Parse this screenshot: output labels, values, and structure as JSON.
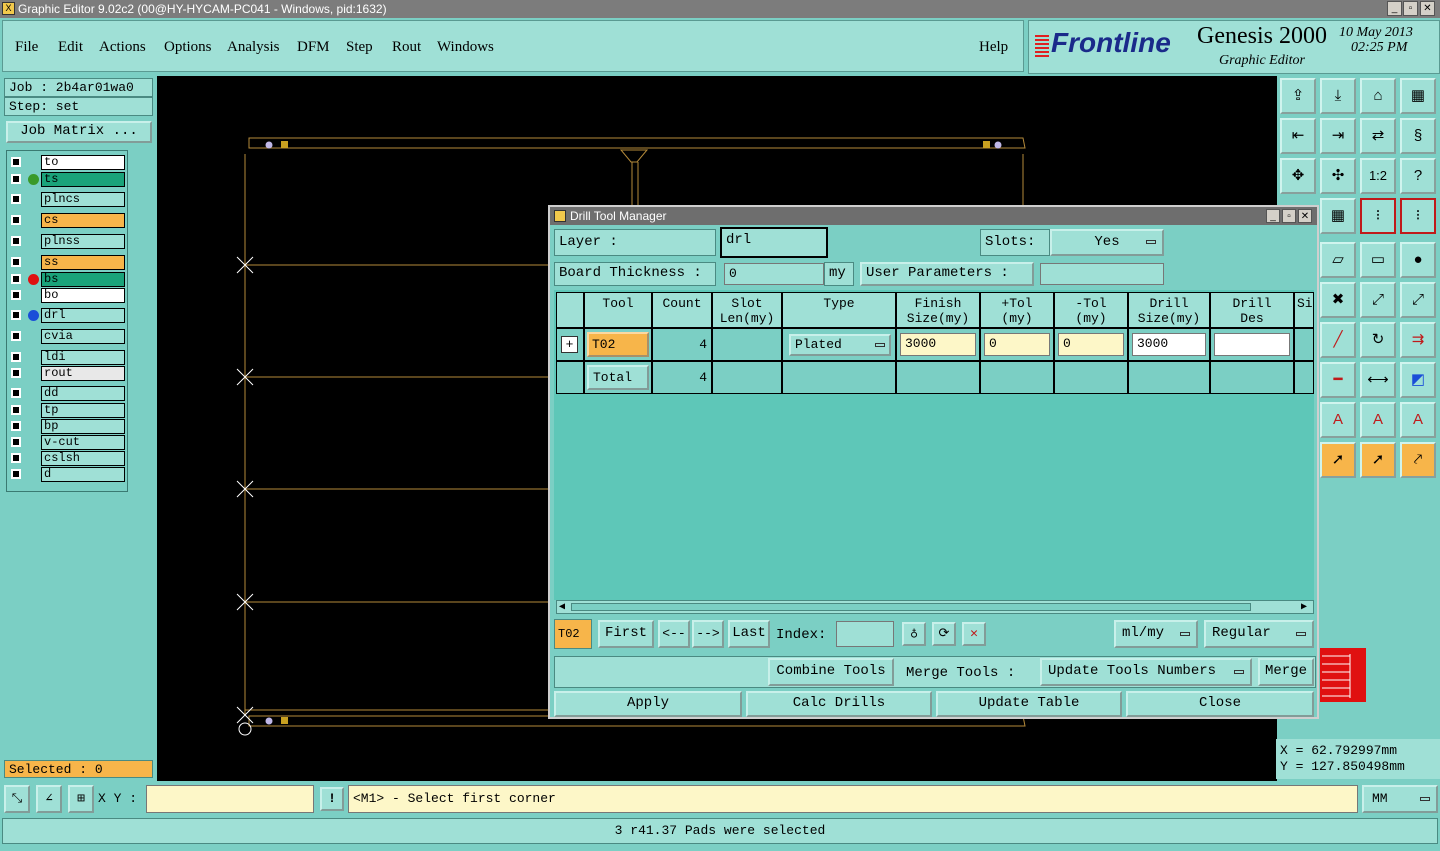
{
  "window": {
    "title": "Graphic Editor 9.02c2 (00@HY-HYCAM-PC041 - Windows, pid:1632)"
  },
  "menu": {
    "items": [
      "File",
      "Edit",
      "Actions",
      "Options",
      "Analysis",
      "DFM",
      "Step",
      "Rout",
      "Windows"
    ],
    "help": "Help"
  },
  "brand": {
    "logo": "Frontline",
    "product": "Genesis 2000",
    "subtitle": "Graphic Editor",
    "date": "10 May 2013",
    "time": "02:25 PM"
  },
  "job": {
    "job": "Job : 2b4ar01wa0",
    "step": "Step: set",
    "matrix_button": "Job Matrix ..."
  },
  "layers": [
    {
      "name": "to",
      "color": "#ffffff",
      "dot": ""
    },
    {
      "name": "ts",
      "color": "#1aa37a",
      "dot": "#3a9a2a"
    },
    {
      "name": "plncs",
      "color": "#9fe0d6",
      "dot": ""
    },
    {
      "name": "cs",
      "color": "#f7b54a",
      "dot": ""
    },
    {
      "name": "plnss",
      "color": "#9fe0d6",
      "dot": ""
    },
    {
      "name": "ss",
      "color": "#f7b54a",
      "dot": ""
    },
    {
      "name": "bs",
      "color": "#1aa37a",
      "dot": "#e01010"
    },
    {
      "name": "bo",
      "color": "#ffffff",
      "dot": ""
    },
    {
      "name": "drl",
      "color": "#9fe0d6",
      "dot": "#1a4ed8"
    },
    {
      "name": "cvia",
      "color": "#9fe0d6",
      "dot": ""
    },
    {
      "name": "ldi",
      "color": "#9fe0d6",
      "dot": ""
    },
    {
      "name": "rout",
      "color": "#e8e8e8",
      "dot": ""
    },
    {
      "name": "dd",
      "color": "#9fe0d6",
      "dot": ""
    },
    {
      "name": "tp",
      "color": "#9fe0d6",
      "dot": ""
    },
    {
      "name": "bp",
      "color": "#9fe0d6",
      "dot": ""
    },
    {
      "name": "v-cut",
      "color": "#9fe0d6",
      "dot": ""
    },
    {
      "name": "cslsh",
      "color": "#9fe0d6",
      "dot": ""
    },
    {
      "name": "d",
      "color": "#9fe0d6",
      "dot": ""
    }
  ],
  "selected": "Selected : 0",
  "dialog": {
    "title": "Drill Tool Manager",
    "layer_label": "Layer            :",
    "layer_value": "drl",
    "slots_label": "Slots:",
    "slots_value": "Yes",
    "thickness_label": "Board Thickness  :",
    "thickness_value": "0",
    "thickness_unit": "my",
    "user_params": "User Parameters :",
    "user_params_value": "",
    "headers": [
      "Tool",
      "Count",
      "Slot\nLen(my)",
      "Type",
      "Finish\nSize(my)",
      "+Tol\n(my)",
      "-Tol\n(my)",
      "Drill\nSize(my)",
      "Drill\nDes",
      "Si"
    ],
    "rows": [
      {
        "tool": "T02",
        "count": "4",
        "type": "Plated",
        "finish": "3000",
        "ptol": "0",
        "mtol": "0",
        "drill": "3000",
        "des": ""
      }
    ],
    "total": {
      "label": "Total",
      "count": "4"
    },
    "nav": {
      "current": "T02",
      "first": "First",
      "prev": "<--",
      "next": "-->",
      "last": "Last",
      "index_label": "Index:",
      "index_value": "",
      "units": "ml/my",
      "mode": "Regular"
    },
    "actions": {
      "combine": "Combine Tools",
      "merge_label": "Merge Tools :",
      "update_numbers": "Update Tools Numbers",
      "merge": "Merge"
    },
    "bottom": {
      "apply": "Apply",
      "calc": "Calc Drills",
      "update": "Update Table",
      "close": "Close"
    }
  },
  "coords": {
    "x": "X = 62.792997mm",
    "y": "Y = 127.850498mm"
  },
  "status": {
    "xy_label": "X Y :",
    "xy_value": "",
    "prompt": "<M1> - Select first corner",
    "units": "MM"
  },
  "info": "3 r41.37 Pads were selected"
}
